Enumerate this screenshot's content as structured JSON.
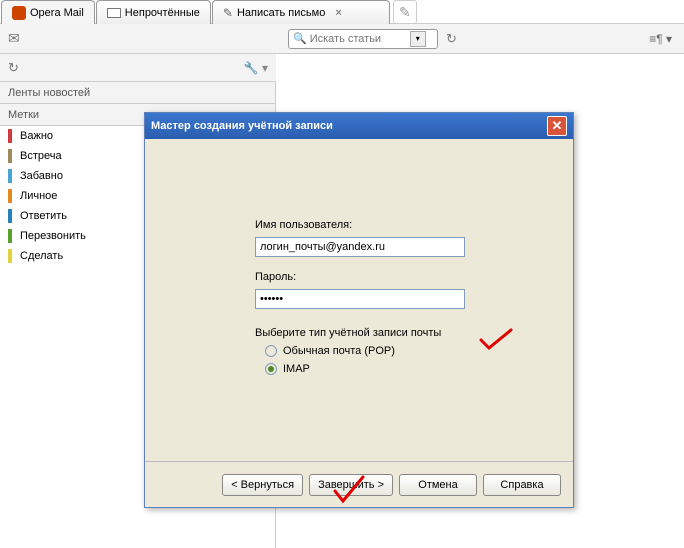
{
  "tabs": {
    "app": "Opera Mail",
    "unread": "Непрочтённые",
    "compose": "Написать письмо"
  },
  "search": {
    "placeholder": "Искать статьи"
  },
  "sidebar": {
    "feeds_header": "Ленты новостей",
    "labels_header": "Метки",
    "items": [
      {
        "label": "Важно",
        "color": "#d43a3a"
      },
      {
        "label": "Встреча",
        "color": "#9f8a60"
      },
      {
        "label": "Забавно",
        "color": "#4aa3d0"
      },
      {
        "label": "Личное",
        "color": "#e28a1b"
      },
      {
        "label": "Ответить",
        "color": "#2a7fbf"
      },
      {
        "label": "Перезвонить",
        "color": "#5aa02c"
      },
      {
        "label": "Сделать",
        "color": "#e0d040"
      }
    ]
  },
  "dialog": {
    "title": "Мастер создания учётной записи",
    "username_label": "Имя пользователя:",
    "username_value": "логин_почты@yandex.ru",
    "password_label": "Пароль:",
    "password_value": "••••••",
    "type_label": "Выберите тип учётной записи почты",
    "option_pop": "Обычная почта (POP)",
    "option_imap": "IMAP",
    "btn_back": "< Вернуться",
    "btn_finish": "Завершить >",
    "btn_cancel": "Отмена",
    "btn_help": "Справка"
  }
}
